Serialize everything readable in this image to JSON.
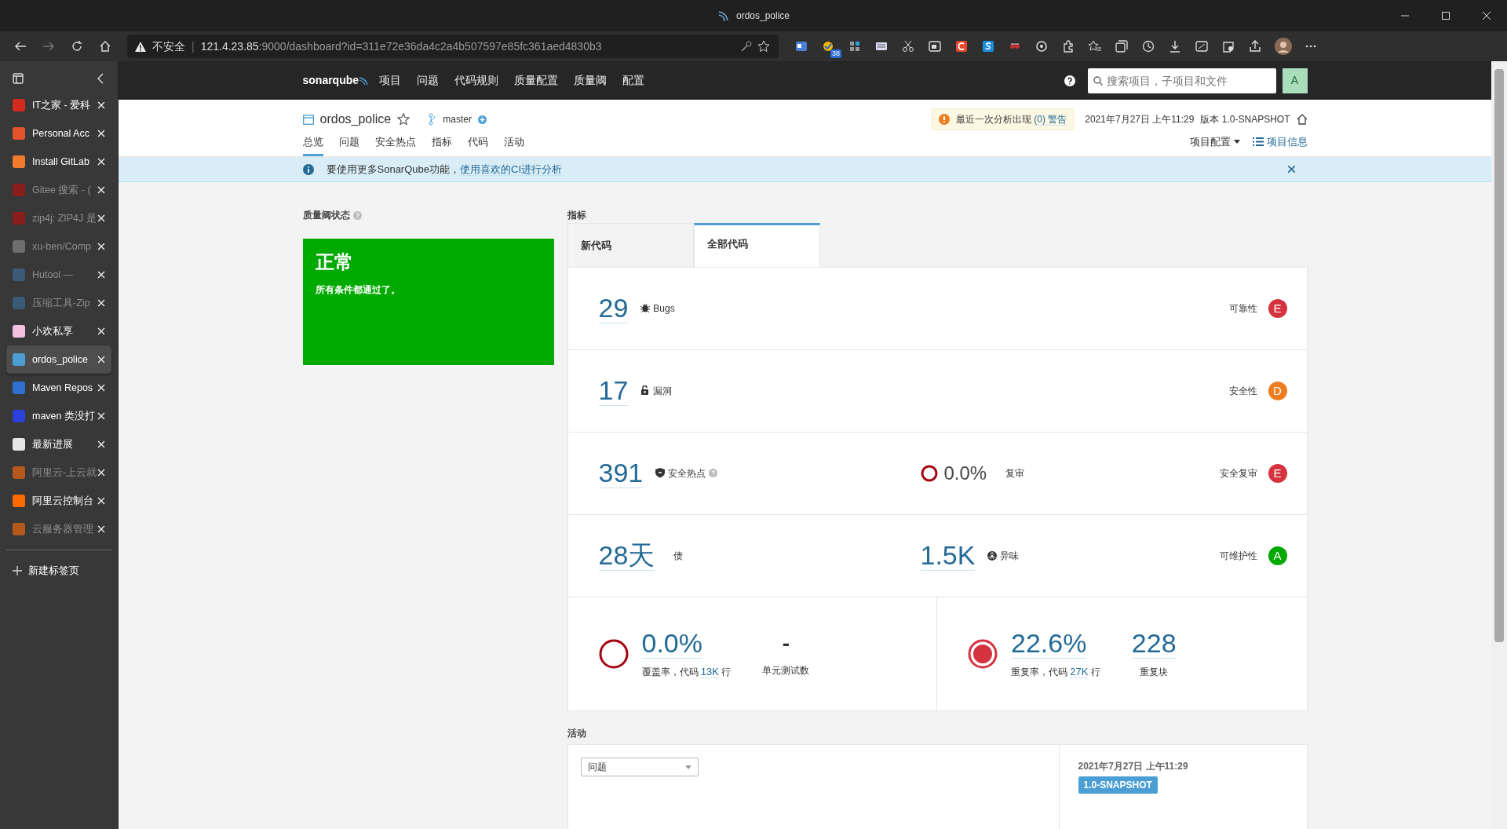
{
  "window": {
    "title": "ordos_police"
  },
  "address_bar": {
    "security": "不安全",
    "separator": "|",
    "host": "121.4.23.85",
    "path": ":9000/dashboard?id=311e72e36da4c2a4b507597e85fc361aed4830b3"
  },
  "extension_badge": "38",
  "tabs": [
    {
      "label": "IT之家 - 爱科",
      "selected": false,
      "dimmed": false,
      "color": "#d42a1f"
    },
    {
      "label": "Personal Acc",
      "selected": false,
      "dimmed": false,
      "color": "#e2532c"
    },
    {
      "label": "Install GitLab",
      "selected": false,
      "dimmed": false,
      "color": "#f07b2c"
    },
    {
      "label": "Gitee 搜索 - (",
      "selected": false,
      "dimmed": true,
      "color": "#8c1d1d"
    },
    {
      "label": "zip4j: ZIP4J 是",
      "selected": false,
      "dimmed": true,
      "color": "#8c1d1d"
    },
    {
      "label": "xu-ben/Comp",
      "selected": false,
      "dimmed": true,
      "color": "#6e6e6e"
    },
    {
      "label": "Hutool —",
      "selected": false,
      "dimmed": true,
      "color": "#3b5a78"
    },
    {
      "label": "压缩工具-Zip",
      "selected": false,
      "dimmed": true,
      "color": "#3b5a78"
    },
    {
      "label": "小欢私享",
      "selected": false,
      "dimmed": false,
      "color": "#f3c1e0"
    },
    {
      "label": "ordos_police",
      "selected": true,
      "dimmed": false,
      "color": "#4b9fd5"
    },
    {
      "label": "Maven Repos",
      "selected": false,
      "dimmed": false,
      "color": "#2f6fcf"
    },
    {
      "label": "maven 类没打",
      "selected": false,
      "dimmed": false,
      "color": "#2d3fd9"
    },
    {
      "label": "最新进展",
      "selected": false,
      "dimmed": false,
      "color": "#e6e6e6"
    },
    {
      "label": "阿里云-上云就",
      "selected": false,
      "dimmed": true,
      "color": "#b5581c"
    },
    {
      "label": "阿里云控制台",
      "selected": false,
      "dimmed": false,
      "color": "#ff6a00"
    },
    {
      "label": "云服务器管理",
      "selected": false,
      "dimmed": true,
      "color": "#b5581c"
    }
  ],
  "new_tab": "新建标签页",
  "sonar_nav": {
    "logo": "sonarqube",
    "items": [
      "项目",
      "问题",
      "代码规则",
      "质量配置",
      "质量阈",
      "配置"
    ],
    "search": {
      "placeholder": "搜索项目，子项目和文件"
    },
    "avatar": "A"
  },
  "project": {
    "name": "ordos_police",
    "branch": "master",
    "warning": {
      "text": "最近一次分析出现",
      "link": "(0) 警告"
    },
    "date": "2021年7月27日 上午11:29",
    "version": "版本 1.0-SNAPSHOT",
    "tabs": [
      {
        "label": "总览",
        "selected": true
      },
      {
        "label": "问题",
        "selected": false
      },
      {
        "label": "安全热点",
        "selected": false
      },
      {
        "label": "指标",
        "selected": false
      },
      {
        "label": "代码",
        "selected": false
      },
      {
        "label": "活动",
        "selected": false
      }
    ],
    "settings": "项目配置",
    "info": "项目信息"
  },
  "banner": {
    "text": "要使用更多SonarQube功能，",
    "link": "使用喜欢的CI进行分析"
  },
  "quality_gate": {
    "title": "质量阈状态",
    "status": "正常",
    "message": "所有条件都通过了。",
    "color": "#00aa00"
  },
  "metrics": {
    "title": "指标",
    "tabs": [
      {
        "label": "新代码",
        "selected": false
      },
      {
        "label": "全部代码",
        "selected": true
      }
    ],
    "rows": [
      {
        "kind": "bugs",
        "value": "29",
        "label": "Bugs",
        "rating_label": "可靠性",
        "rating": {
          "letter": "E",
          "color": "#d4333f"
        }
      },
      {
        "kind": "vulnerabilities",
        "value": "17",
        "label": "漏洞",
        "rating_label": "安全性",
        "rating": {
          "letter": "D",
          "color": "#ed7d20"
        }
      },
      {
        "kind": "hotspots",
        "value": "391",
        "label": "安全热点",
        "help": true,
        "second": {
          "kind": "review",
          "value": "0.0%",
          "label": "复审"
        },
        "rating_label": "安全复审",
        "rating": {
          "letter": "E",
          "color": "#d4333f"
        }
      },
      {
        "kind": "debt",
        "value": "28天",
        "label": "债",
        "second": {
          "kind": "smells",
          "value": "1.5K",
          "label": "异味"
        },
        "rating_label": "可维护性",
        "rating": {
          "letter": "A",
          "color": "#00aa00"
        }
      }
    ],
    "coverage": {
      "value": "0.0%",
      "label": "覆盖率，代码",
      "lines": "13K",
      "unit": "行",
      "tests_value": "-",
      "tests_label": "单元测试数"
    },
    "duplications": {
      "value": "22.6%",
      "label": "重复率，代码",
      "lines": "27K",
      "unit": "行",
      "blocks_value": "228",
      "blocks_label": "重复块"
    }
  },
  "activity": {
    "title": "活动",
    "filter": "问题",
    "date": "2021年7月27日 上午11:29",
    "version": "1.0-SNAPSHOT"
  }
}
